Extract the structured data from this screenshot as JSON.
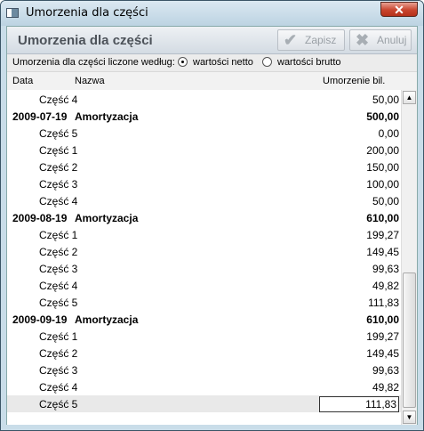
{
  "window": {
    "title": "Umorzenia dla części",
    "close_glyph": "✕"
  },
  "header": {
    "title": "Umorzenia dla części"
  },
  "toolbar": {
    "save_label": "Zapisz",
    "cancel_label": "Anuluj",
    "save_icon": "check-icon",
    "cancel_icon": "x-icon"
  },
  "options": {
    "label": "Umorzenia dla części liczone według:",
    "net_label": "wartości netto",
    "gross_label": "wartości brutto",
    "selected": "net"
  },
  "columns": {
    "date": "Data",
    "name": "Nazwa",
    "amount": "Umorzenie bil."
  },
  "rows": [
    {
      "type": "part",
      "date": "",
      "name": "Część 4",
      "amount": "50,00"
    },
    {
      "type": "group",
      "date": "2009-07-19",
      "name": "Amortyzacja",
      "amount": "500,00"
    },
    {
      "type": "part",
      "date": "",
      "name": "Część 5",
      "amount": "0,00"
    },
    {
      "type": "part",
      "date": "",
      "name": "Część 1",
      "amount": "200,00"
    },
    {
      "type": "part",
      "date": "",
      "name": "Część 2",
      "amount": "150,00"
    },
    {
      "type": "part",
      "date": "",
      "name": "Część 3",
      "amount": "100,00"
    },
    {
      "type": "part",
      "date": "",
      "name": "Część 4",
      "amount": "50,00"
    },
    {
      "type": "group",
      "date": "2009-08-19",
      "name": "Amortyzacja",
      "amount": "610,00"
    },
    {
      "type": "part",
      "date": "",
      "name": "Część 1",
      "amount": "199,27"
    },
    {
      "type": "part",
      "date": "",
      "name": "Część 2",
      "amount": "149,45"
    },
    {
      "type": "part",
      "date": "",
      "name": "Część 3",
      "amount": "99,63"
    },
    {
      "type": "part",
      "date": "",
      "name": "Część 4",
      "amount": "49,82"
    },
    {
      "type": "part",
      "date": "",
      "name": "Część 5",
      "amount": "111,83"
    },
    {
      "type": "group",
      "date": "2009-09-19",
      "name": "Amortyzacja",
      "amount": "610,00"
    },
    {
      "type": "part",
      "date": "",
      "name": "Część 1",
      "amount": "199,27"
    },
    {
      "type": "part",
      "date": "",
      "name": "Część 2",
      "amount": "149,45"
    },
    {
      "type": "part",
      "date": "",
      "name": "Część 3",
      "amount": "99,63"
    },
    {
      "type": "part",
      "date": "",
      "name": "Część 4",
      "amount": "49,82"
    },
    {
      "type": "part",
      "date": "",
      "name": "Część 5",
      "amount": "111,83"
    }
  ]
}
